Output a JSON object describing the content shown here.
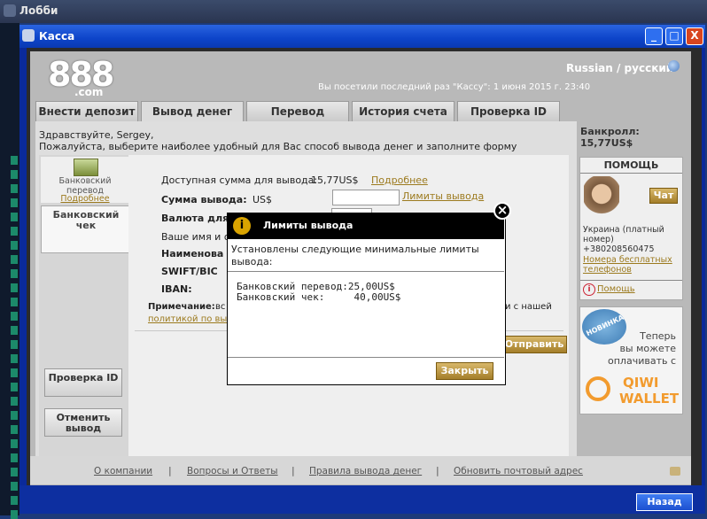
{
  "lobby": {
    "title": "Лобби"
  },
  "window": {
    "title": "Касса",
    "minimize": "_",
    "maximize": "□",
    "close": "X"
  },
  "header": {
    "logo": "888",
    "logo_sub": ".com",
    "language": "Russian / русский",
    "last_visit": "Вы посетили последний раз \"Кассу\": 1 июня 2015 г. 23:40"
  },
  "tabs": [
    {
      "label": "Внести депозит"
    },
    {
      "label": "Вывод денег"
    },
    {
      "label": "Перевод"
    },
    {
      "label": "История счета"
    },
    {
      "label": "Проверка ID"
    }
  ],
  "greeting": {
    "line1": "Здравствуйте, Sergey,",
    "line2": "Пожалуйста, выберите наиболее удобный для Вас способ вывода денег и заполните форму"
  },
  "bankroll": {
    "label": "Банкролл:",
    "value": "15,77US$"
  },
  "methods": {
    "bank_transfer": "Банковский перевод",
    "more": "Подробнее",
    "bank_check": "Банковский чек"
  },
  "form": {
    "available_label": "Доступная сумма для вывода:",
    "available_value": "15,77US$",
    "available_more": "Подробнее",
    "amount_label": "Сумма вывода:",
    "amount_currency": "US$",
    "amount_value": "",
    "limits_link": "Лимиты вывода",
    "currency_label": "Валюта для",
    "name_label": "Ваше имя и о",
    "bank_name_label": "Наименова",
    "swift_label": "SWIFT/BIC",
    "iban_label": "IBAN:",
    "note_label": "Примечание:",
    "note_text_start": "вс",
    "note_text_end": "и с нашей",
    "policy_link": "политикой по выв",
    "send_button": "Отправить"
  },
  "left_buttons": {
    "verify": "Проверка ID",
    "cancel": "Отменить вывод"
  },
  "help": {
    "title": "ПОМОЩЬ",
    "chat": "Чат",
    "phone_line1": "Украина (платный",
    "phone_line2": "номер)",
    "phone_number": "+380208560475",
    "free_numbers": "Номера бесплатных телефонов",
    "help_link": "Помощь"
  },
  "promo": {
    "badge": "НОВИНКА",
    "line1": "Теперь",
    "line2": "вы можете",
    "line3": "оплачивать с",
    "brand1": "QIWI",
    "brand2": "WALLET"
  },
  "footer": {
    "links": [
      "О компании",
      "Вопросы и Ответы",
      "Правила вывода денег",
      "Обновить почтовый адрес"
    ],
    "separator": "|"
  },
  "back_button": "Назад",
  "modal": {
    "title": "Лимиты вывода",
    "intro": "Установлены следующие минимальные лимиты вывода:",
    "row1": "Банковский перевод:25,00US$",
    "row2": "Банковский чек:     40,00US$",
    "close_button": "Закрыть",
    "info_icon": "i",
    "close_icon": "×"
  },
  "colors": {
    "accent_gold": "#a47e2a",
    "title_blue": "#0d44c9",
    "link_gold": "#9c7a1e"
  }
}
